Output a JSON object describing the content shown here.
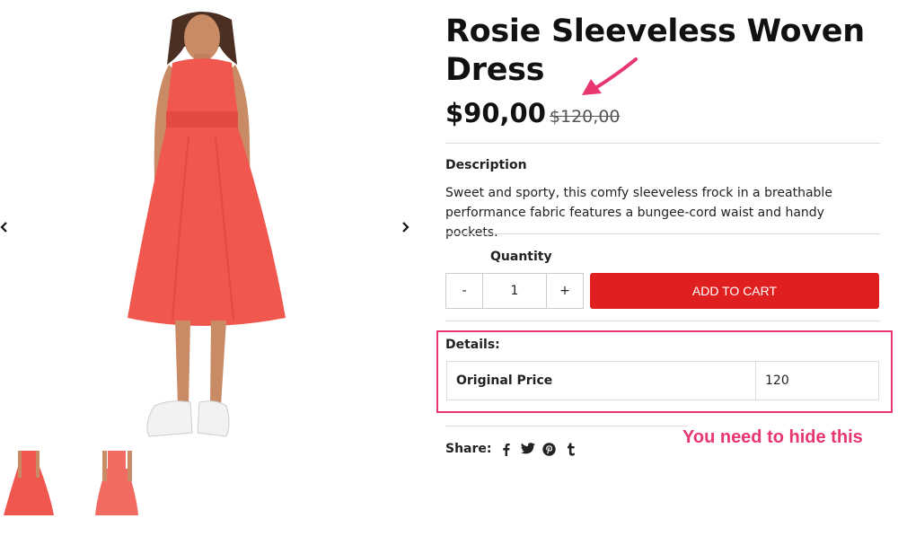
{
  "product": {
    "title": "Rosie Sleeveless Woven Dress",
    "price": "$90,00",
    "old_price": "$120,00"
  },
  "gallery": {
    "prev_icon": "chevron-left-icon",
    "next_icon": "chevron-right-icon",
    "dress_color": "#f0574f"
  },
  "description": {
    "label": "Description",
    "text": "Sweet and sporty, this comfy sleeveless frock in a breathable performance fabric features a bungee-cord waist and handy pockets."
  },
  "quantity": {
    "label": "Quantity",
    "minus": "-",
    "value": "1",
    "plus": "+"
  },
  "cart": {
    "button_label": "ADD TO CART",
    "button_color": "#e02020"
  },
  "details": {
    "label": "Details:",
    "rows": [
      {
        "key": "Original Price",
        "value": "120"
      }
    ]
  },
  "annotation": {
    "note": "You need to hide this",
    "color": "#e8366f"
  },
  "share": {
    "label": "Share:",
    "icons": [
      "facebook-icon",
      "twitter-icon",
      "pinterest-icon",
      "tumblr-icon"
    ]
  }
}
